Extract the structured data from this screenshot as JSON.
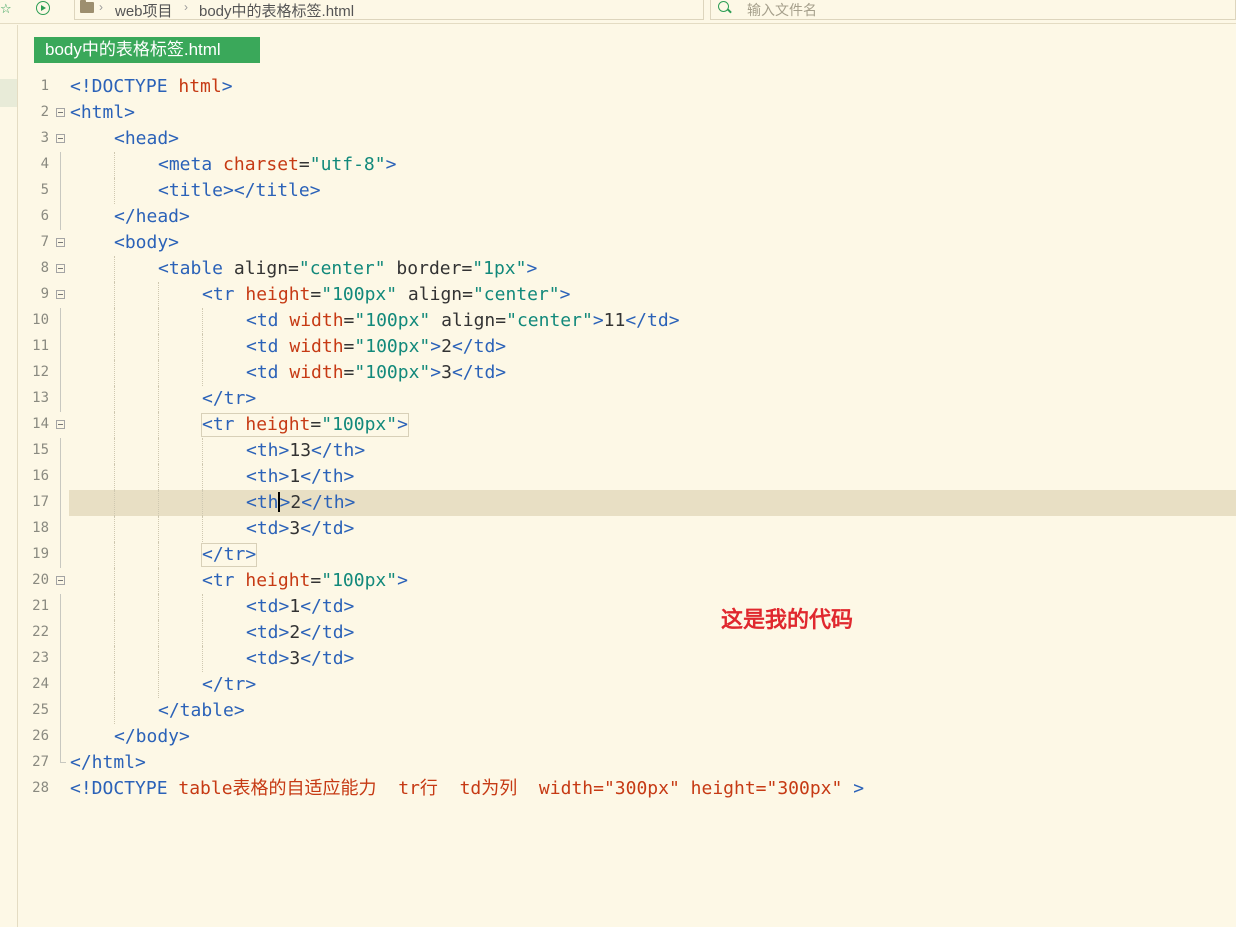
{
  "toolbar": {
    "star_icon": "star-icon",
    "run_icon": "run-icon",
    "breadcrumb": [
      "web项目",
      "body中的表格标签.html"
    ],
    "search_placeholder": "输入文件名"
  },
  "tab": {
    "title": "body中的表格标签.html",
    "color": "#3aa85a"
  },
  "editor": {
    "current_line": 17,
    "lines": [
      {
        "n": "1",
        "tokens": [
          [
            "tag",
            "<!DOCTYPE "
          ],
          [
            "attr",
            "html"
          ],
          [
            "tag",
            ">"
          ]
        ]
      },
      {
        "n": "2",
        "tokens": [
          [
            "tag",
            "<html>"
          ]
        ]
      },
      {
        "n": "3",
        "tokens": [
          [
            "tag",
            "<head>"
          ]
        ]
      },
      {
        "n": "4",
        "tokens": [
          [
            "tag",
            "<meta "
          ],
          [
            "attr",
            "charset"
          ],
          [
            "plain",
            "="
          ],
          [
            "str",
            "\"utf-8\""
          ],
          [
            "tag",
            ">"
          ]
        ]
      },
      {
        "n": "5",
        "tokens": [
          [
            "tag",
            "<title></title>"
          ]
        ]
      },
      {
        "n": "6",
        "tokens": [
          [
            "tag",
            "</head>"
          ]
        ]
      },
      {
        "n": "7",
        "tokens": [
          [
            "tag",
            "<body>"
          ]
        ]
      },
      {
        "n": "8",
        "tokens": [
          [
            "tag",
            "<table "
          ],
          [
            "plain",
            "align="
          ],
          [
            "str",
            "\"center\""
          ],
          [
            "plain",
            " border="
          ],
          [
            "str",
            "\"1px\""
          ],
          [
            "tag",
            ">"
          ]
        ]
      },
      {
        "n": "9",
        "tokens": [
          [
            "tag",
            "<tr "
          ],
          [
            "attr",
            "height"
          ],
          [
            "plain",
            "="
          ],
          [
            "str",
            "\"100px\""
          ],
          [
            "plain",
            " align="
          ],
          [
            "str",
            "\"center\""
          ],
          [
            "tag",
            ">"
          ]
        ]
      },
      {
        "n": "10",
        "tokens": [
          [
            "tag",
            "<td "
          ],
          [
            "attr",
            "width"
          ],
          [
            "plain",
            "="
          ],
          [
            "str",
            "\"100px\""
          ],
          [
            "plain",
            " align="
          ],
          [
            "str",
            "\"center\""
          ],
          [
            "tag",
            ">"
          ],
          [
            "txt",
            "11"
          ],
          [
            "tag",
            "</td>"
          ]
        ]
      },
      {
        "n": "11",
        "tokens": [
          [
            "tag",
            "<td "
          ],
          [
            "attr",
            "width"
          ],
          [
            "plain",
            "="
          ],
          [
            "str",
            "\"100px\""
          ],
          [
            "tag",
            ">"
          ],
          [
            "txt",
            "2"
          ],
          [
            "tag",
            "</td>"
          ]
        ]
      },
      {
        "n": "12",
        "tokens": [
          [
            "tag",
            "<td "
          ],
          [
            "attr",
            "width"
          ],
          [
            "plain",
            "="
          ],
          [
            "str",
            "\"100px\""
          ],
          [
            "tag",
            ">"
          ],
          [
            "txt",
            "3"
          ],
          [
            "tag",
            "</td>"
          ]
        ]
      },
      {
        "n": "13",
        "tokens": [
          [
            "tag",
            "</tr>"
          ]
        ]
      },
      {
        "n": "14",
        "tokens": [
          [
            "tag",
            "<tr "
          ],
          [
            "attr",
            "height"
          ],
          [
            "plain",
            "="
          ],
          [
            "str",
            "\"100px\""
          ],
          [
            "tag",
            ">"
          ]
        ]
      },
      {
        "n": "15",
        "tokens": [
          [
            "tag",
            "<th>"
          ],
          [
            "txt",
            "13"
          ],
          [
            "tag",
            "</th>"
          ]
        ]
      },
      {
        "n": "16",
        "tokens": [
          [
            "tag",
            "<th>"
          ],
          [
            "txt",
            "1"
          ],
          [
            "tag",
            "</th>"
          ]
        ]
      },
      {
        "n": "17",
        "tokens": [
          [
            "tag",
            "<th"
          ],
          [
            "caret",
            ""
          ],
          [
            "tag",
            ">"
          ],
          [
            "txt",
            "2"
          ],
          [
            "tag",
            "</th>"
          ]
        ]
      },
      {
        "n": "18",
        "tokens": [
          [
            "tag",
            "<td>"
          ],
          [
            "txt",
            "3"
          ],
          [
            "tag",
            "</td>"
          ]
        ]
      },
      {
        "n": "19",
        "tokens": [
          [
            "tag",
            "</tr>"
          ]
        ]
      },
      {
        "n": "20",
        "tokens": [
          [
            "tag",
            "<tr "
          ],
          [
            "attr",
            "height"
          ],
          [
            "plain",
            "="
          ],
          [
            "str",
            "\"100px\""
          ],
          [
            "tag",
            ">"
          ]
        ]
      },
      {
        "n": "21",
        "tokens": [
          [
            "tag",
            "<td>"
          ],
          [
            "txt",
            "1"
          ],
          [
            "tag",
            "</td>"
          ]
        ]
      },
      {
        "n": "22",
        "tokens": [
          [
            "tag",
            "<td>"
          ],
          [
            "txt",
            "2"
          ],
          [
            "tag",
            "</td>"
          ]
        ]
      },
      {
        "n": "23",
        "tokens": [
          [
            "tag",
            "<td>"
          ],
          [
            "txt",
            "3"
          ],
          [
            "tag",
            "</td>"
          ]
        ]
      },
      {
        "n": "24",
        "tokens": [
          [
            "tag",
            "</tr>"
          ]
        ]
      },
      {
        "n": "25",
        "tokens": [
          [
            "tag",
            "</table>"
          ]
        ]
      },
      {
        "n": "26",
        "tokens": [
          [
            "tag",
            "</body>"
          ]
        ]
      },
      {
        "n": "27",
        "tokens": [
          [
            "tag",
            "</html>"
          ]
        ]
      },
      {
        "n": "28",
        "tokens": [
          [
            "tag",
            "<!DOCTYPE "
          ],
          [
            "attr",
            "table表格的自适应能力  tr行  td为列  width=\"300px\" height=\"300px\" "
          ],
          [
            "tag",
            ">"
          ]
        ]
      }
    ]
  },
  "note": {
    "text": "这是我的代码",
    "color": "#e0282e"
  }
}
